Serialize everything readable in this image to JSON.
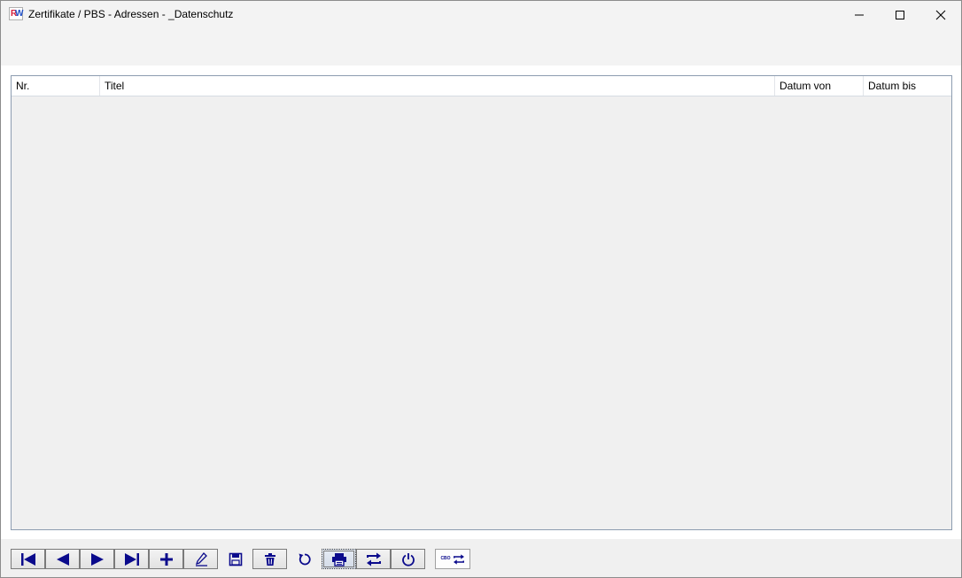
{
  "window": {
    "title": "Zertifikate / PBS - Adressen - _Datenschutz",
    "app_icon": "rw-app-icon"
  },
  "grid": {
    "columns": [
      {
        "key": "nr",
        "label": "Nr."
      },
      {
        "key": "titel",
        "label": "Titel"
      },
      {
        "key": "datum_von",
        "label": "Datum von"
      },
      {
        "key": "datum_bis",
        "label": "Datum bis"
      }
    ],
    "rows": []
  },
  "navigator": {
    "buttons": [
      {
        "name": "first-record-button",
        "icon": "first-icon"
      },
      {
        "name": "previous-record-button",
        "icon": "previous-icon"
      },
      {
        "name": "next-record-button",
        "icon": "next-icon"
      },
      {
        "name": "last-record-button",
        "icon": "last-icon"
      },
      {
        "name": "add-record-button",
        "icon": "plus-icon"
      },
      {
        "name": "edit-record-button",
        "icon": "pencil-icon"
      },
      {
        "name": "save-record-button",
        "icon": "floppy-icon"
      },
      {
        "name": "delete-record-button",
        "icon": "trash-icon"
      },
      {
        "name": "refresh-button",
        "icon": "refresh-icon"
      },
      {
        "name": "print-button",
        "icon": "printer-icon"
      },
      {
        "name": "switch-button",
        "icon": "swap-arrows-icon"
      },
      {
        "name": "close-form-button",
        "icon": "power-icon"
      }
    ],
    "extra_button": {
      "name": "cbo-switch-button",
      "icon": "cbo-swap-icon",
      "label": "CBO"
    }
  },
  "colors": {
    "icon_navy": "#0a0a8c",
    "accent_red": "#d8203a",
    "accent_blue": "#2050c8"
  }
}
